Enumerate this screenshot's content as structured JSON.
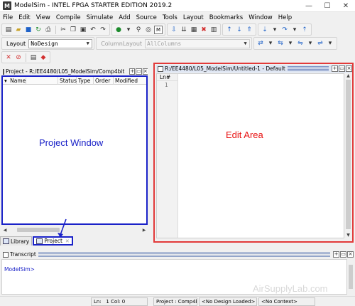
{
  "window": {
    "title": "ModelSim - INTEL FPGA STARTER EDITION 2019.2",
    "app_icon": "M",
    "controls": [
      "—",
      "☐",
      "✕"
    ]
  },
  "menu": [
    "File",
    "Edit",
    "View",
    "Compile",
    "Simulate",
    "Add",
    "Source",
    "Tools",
    "Layout",
    "Bookmarks",
    "Window",
    "Help"
  ],
  "toolbar2": {
    "layout_label": "Layout",
    "layout_value": "NoDesign",
    "column_layout_label": "ColumnLayout",
    "column_layout_value": "AllColumns"
  },
  "project_pane": {
    "title": "Project - R:/EE4480/L05_ModelSim/Comp4bit",
    "columns": [
      "Name",
      "Status",
      "Type",
      "Order",
      "Modified"
    ]
  },
  "tabs": [
    {
      "label": "Library"
    },
    {
      "label": "Project"
    }
  ],
  "editor": {
    "title": "R:/EE4480/L05_ModelSim/Untitled-1 - Default",
    "gutter_header": "Ln#",
    "lines": [
      "1"
    ]
  },
  "annotations": {
    "project_window": "Project Window",
    "edit_area": "Edit Area"
  },
  "transcript": {
    "title": "Transcript",
    "prompt": "ModelSim>"
  },
  "watermark": "AirSupplyLab.com",
  "status": {
    "ln": "Ln:",
    "ln_value": "1",
    "col": "Col: 0",
    "project": "Project : Comp4bit",
    "design": "<No Design Loaded>",
    "context": "<No Context>"
  }
}
